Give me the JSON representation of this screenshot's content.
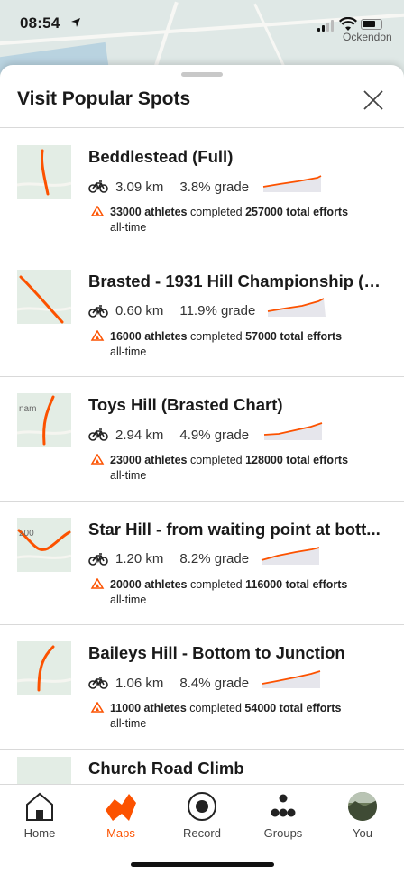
{
  "status_bar": {
    "time": "08:54",
    "place": "Ockendon"
  },
  "sheet": {
    "title": "Visit Popular Spots"
  },
  "segments": [
    {
      "name": "Beddlestead (Full)",
      "distance": "3.09 km",
      "grade": "3.8% grade",
      "athletes": "33000 athletes",
      "completed": " completed ",
      "efforts": "257000 total efforts",
      "period": "all-time",
      "map_label": ""
    },
    {
      "name": "Brasted - 1931 Hill Championship (E...",
      "distance": "0.60 km",
      "grade": "11.9% grade",
      "athletes": "16000 athletes",
      "completed": " completed ",
      "efforts": "57000 total efforts",
      "period": "all-time",
      "map_label": ""
    },
    {
      "name": "Toys Hill (Brasted Chart)",
      "distance": "2.94 km",
      "grade": "4.9% grade",
      "athletes": "23000 athletes",
      "completed": " completed ",
      "efforts": "128000 total efforts",
      "period": "all-time",
      "map_label": "nam"
    },
    {
      "name": "Star Hill - from waiting point at bott...",
      "distance": "1.20 km",
      "grade": "8.2% grade",
      "athletes": "20000 athletes",
      "completed": " completed ",
      "efforts": "116000 total efforts",
      "period": "all-time",
      "map_label": "200"
    },
    {
      "name": "Baileys Hill - Bottom to Junction",
      "distance": "1.06 km",
      "grade": "8.4% grade",
      "athletes": "11000 athletes",
      "completed": " completed ",
      "efforts": "54000 total efforts",
      "period": "all-time",
      "map_label": ""
    }
  ],
  "partial_segment": {
    "name": "Church Road Climb"
  },
  "tabs": [
    {
      "label": "Home",
      "icon": "home-icon"
    },
    {
      "label": "Maps",
      "icon": "maps-icon"
    },
    {
      "label": "Record",
      "icon": "record-icon"
    },
    {
      "label": "Groups",
      "icon": "groups-icon"
    },
    {
      "label": "You",
      "icon": "avatar-icon"
    }
  ],
  "active_tab": "Maps",
  "colors": {
    "accent": "#fc5200",
    "map_green": "#e3ede5",
    "profile_fill": "#e6e6ec"
  }
}
